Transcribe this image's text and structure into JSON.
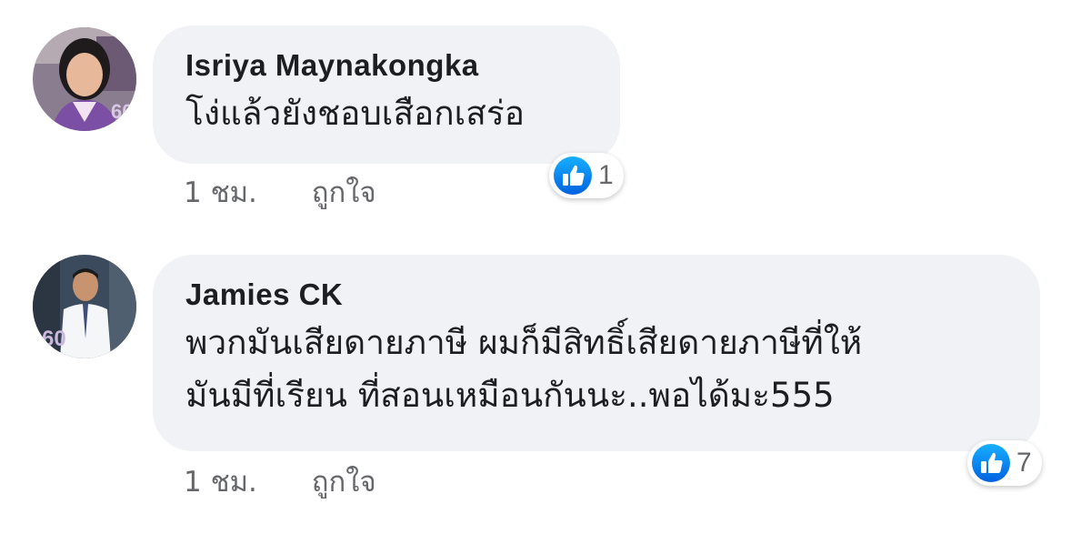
{
  "colors": {
    "bubble_bg": "#f0f2f5",
    "text": "#1c1e21",
    "meta": "#65676b",
    "like_blue": "#1877f2"
  },
  "comments": [
    {
      "author": "Isriya Maynakongka",
      "text_lines": [
        "โง่แล้วยังชอบเสือกเสร่อ"
      ],
      "time": "1 ชม.",
      "like_label": "ถูกใจ",
      "reaction_icon": "like-icon",
      "reaction_count": "1"
    },
    {
      "author": "Jamies CK",
      "text_lines": [
        "พวกมันเสียดายภาษี ผมก็มีสิทธิ์เสียดายภาษีที่ให้",
        "มันมีที่เรียน ที่สอนเหมือนกันนะ..พอได้มะ555"
      ],
      "time": "1 ชม.",
      "like_label": "ถูกใจ",
      "reaction_icon": "like-icon",
      "reaction_count": "7"
    }
  ]
}
